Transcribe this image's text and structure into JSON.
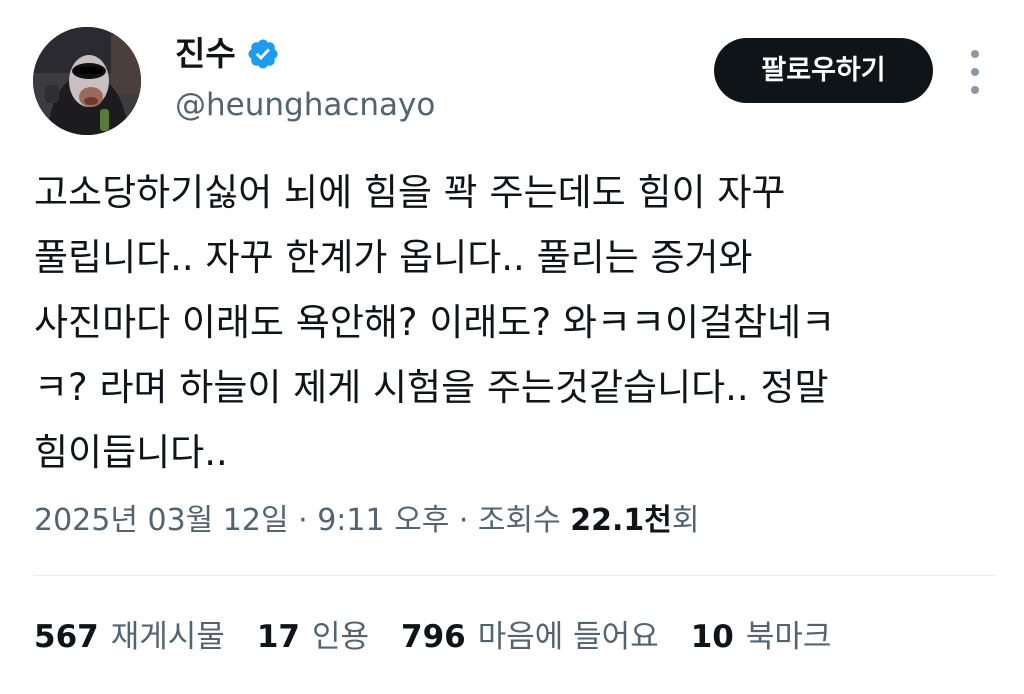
{
  "author": {
    "display_name": "진수",
    "handle": "@heunghacnayo",
    "verified_icon": "verified-badge-icon",
    "verified_color": "#1d9bf0",
    "avatar_icon": "profile-avatar-image"
  },
  "actions": {
    "follow_label": "팔로우하기",
    "more_icon": "more-vertical-icon"
  },
  "tweet": {
    "lines": [
      "고소당하기싫어 뇌에 힘을 꽉 주는데도 힘이 자꾸",
      "풀립니다.. 자꾸 한계가 옵니다.. 풀리는 증거와",
      "사진마다 이래도 욕안해? 이래도? 와ㅋㅋ이걸참네ㅋ",
      "ㅋ? 라며 하늘이 제게 시험을 주는것같습니다.. 정말",
      "힘이듭니다.."
    ]
  },
  "meta": {
    "date": "2025년 03월 12일",
    "separator": " · ",
    "time": "9:11 오후",
    "views_label": "조회수",
    "views_value": "22.1천",
    "views_suffix": "회"
  },
  "stats": [
    {
      "value": "567",
      "label": "재게시물"
    },
    {
      "value": "17",
      "label": "인용"
    },
    {
      "value": "796",
      "label": "마음에 들어요"
    },
    {
      "value": "10",
      "label": "북마크"
    }
  ],
  "colors": {
    "text": "#0f1419",
    "secondary": "#536471",
    "button_bg": "#0f1419",
    "divider": "#e6ecf0"
  }
}
